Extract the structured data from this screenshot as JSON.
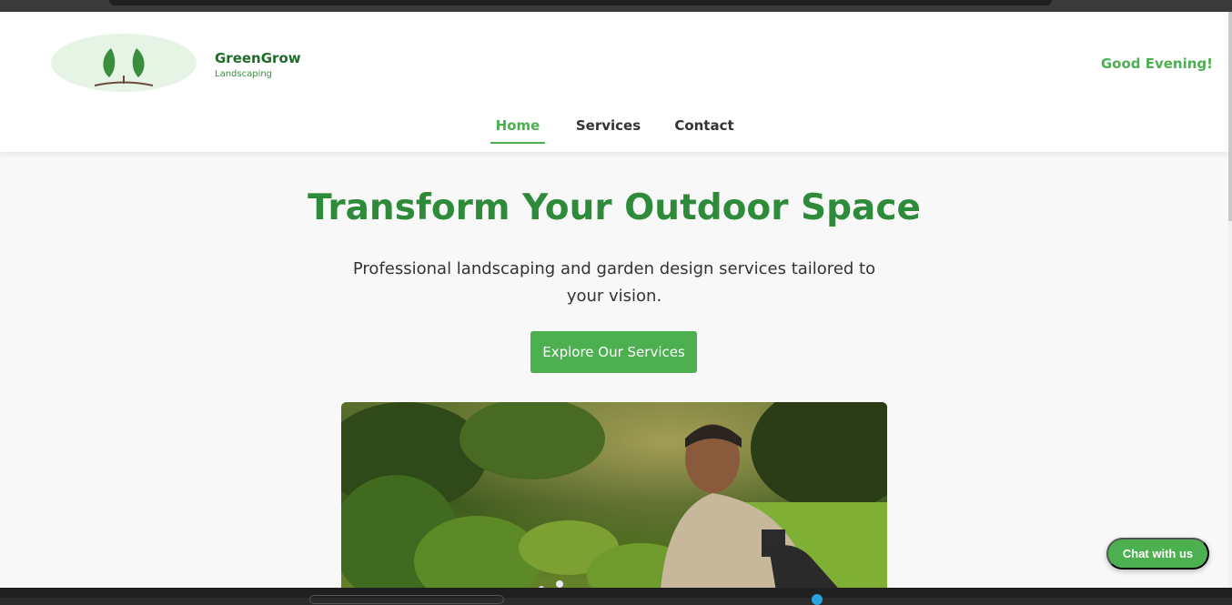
{
  "brand": {
    "name": "GreenGrow",
    "tagline": "Landscaping",
    "logo_icon": "leaf-sprout-icon"
  },
  "header": {
    "greeting": "Good Evening!"
  },
  "nav": {
    "items": [
      {
        "label": "Home",
        "active": true
      },
      {
        "label": "Services",
        "active": false
      },
      {
        "label": "Contact",
        "active": false
      }
    ]
  },
  "hero": {
    "title": "Transform Your Outdoor Space",
    "subtitle": "Professional landscaping and garden design services tailored to your vision.",
    "cta_label": "Explore Our Services"
  },
  "chat": {
    "label": "Chat with us"
  },
  "colors": {
    "accent": "#4caf50",
    "title_green": "#2e8b3a",
    "brand_green": "#1f6b2a",
    "page_bg": "#f8f8f8"
  }
}
